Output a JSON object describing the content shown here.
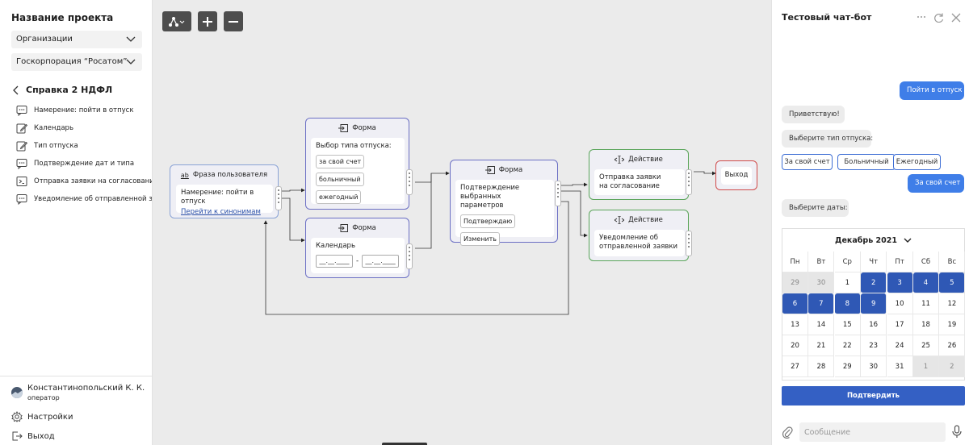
{
  "sidebar": {
    "project_title": "Название проекта",
    "org_select": "Организации",
    "org_value": "Госкорпорация “Росатом”",
    "back_title": "Справка 2 НДФЛ",
    "items": [
      {
        "label": "Намерение: пойти в отпуск",
        "icon": "chat-icon"
      },
      {
        "label": "Календарь",
        "icon": "edit-icon"
      },
      {
        "label": "Тип отпуска",
        "icon": "edit-icon"
      },
      {
        "label": "Подтверждение дат и типа",
        "icon": "chat-icon"
      },
      {
        "label": "Отправка заявки на согласование",
        "icon": "terminal-icon"
      },
      {
        "label": "Уведомление об отправленной заявке",
        "icon": "chat-icon"
      }
    ],
    "user_name": "Константинопольский К. К.",
    "user_role": "оператор",
    "settings": "Настройки",
    "logout": "Выход"
  },
  "canvas": {
    "phrase_node": {
      "title": "Фраза пользователя",
      "intent": "Намерение: пойти в отпуск",
      "link": "Перейти к синонимам"
    },
    "form1": {
      "title": "Форма",
      "question": "Выбор типа отпуска:",
      "options": [
        "за свой счет",
        "больничный",
        "ежегодный"
      ]
    },
    "form2": {
      "title": "Форма",
      "label": "Календарь",
      "date_placeholder": "__.__.____",
      "dash": "-"
    },
    "form3": {
      "title": "Форма",
      "text": "Подтверждение выбранных параметров",
      "buttons": [
        "Подтверждаю",
        "Изменить"
      ]
    },
    "action1": {
      "title": "Действие",
      "text": "Отправка заявки на согласование"
    },
    "action2": {
      "title": "Действие",
      "text": "Уведомление об отправленной заявки"
    },
    "exit_node": {
      "label": "Выход"
    }
  },
  "chat": {
    "title": "Тестовый чат-бот",
    "messages": [
      {
        "from": "user",
        "text": "Пойти в отпуск"
      },
      {
        "from": "bot",
        "text": "Приветствую!"
      },
      {
        "from": "bot",
        "text": "Выберите тип отпуска:"
      },
      {
        "from": "user",
        "text": "За свой счет"
      },
      {
        "from": "bot",
        "text": "Выберите даты:"
      }
    ],
    "options": [
      "За свой счет",
      "Больничный",
      "Ежегодный"
    ],
    "calendar": {
      "month": "Декабрь 2021",
      "weekdays": [
        "Пн",
        "Вт",
        "Ср",
        "Чт",
        "Пт",
        "Сб",
        "Вс"
      ],
      "weeks": [
        [
          "29",
          "30",
          "1",
          "2",
          "3",
          "4",
          "5"
        ],
        [
          "6",
          "7",
          "8",
          "9",
          "10",
          "11",
          "12"
        ],
        [
          "13",
          "14",
          "15",
          "16",
          "17",
          "18",
          "19"
        ],
        [
          "20",
          "21",
          "22",
          "23",
          "24",
          "25",
          "26"
        ],
        [
          "27",
          "28",
          "29",
          "30",
          "31",
          "1",
          "2"
        ]
      ],
      "selected": [
        "2",
        "3",
        "4",
        "5",
        "6",
        "7",
        "8",
        "9"
      ]
    },
    "confirm_button": "Подтвердить",
    "input_placeholder": "Сообщение"
  },
  "colors": {
    "accent": "#3f7ee8",
    "selected_day": "#2f58b5",
    "form_border": "#6b6fc4",
    "action_border": "#5aa55a",
    "exit_border": "#d04a4a"
  }
}
